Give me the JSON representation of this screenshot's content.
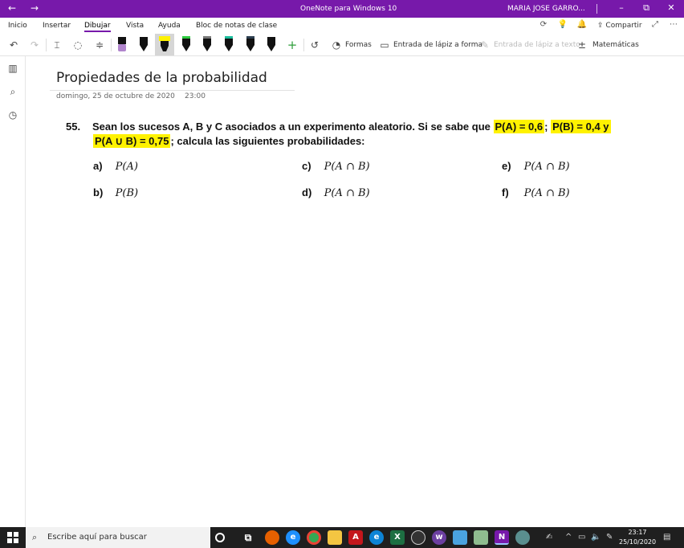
{
  "titlebar": {
    "back_icon": "arrow-left-icon",
    "forward_icon": "arrow-right-icon",
    "app_title": "OneNote para Windows 10",
    "user_name": "MARIA JOSE GARRO...",
    "color": "#7719aa"
  },
  "menu": {
    "tabs": [
      "Inicio",
      "Insertar",
      "Dibujar",
      "Vista",
      "Ayuda",
      "Bloc de notas de clase"
    ],
    "active_tab": "Dibujar",
    "share_label": "Compartir"
  },
  "toolbar": {
    "shapes_label": "Formas",
    "ink_to_shape_label": "Entrada de lápiz a forma",
    "ink_to_text_label": "Entrada de lápiz a texto",
    "math_label": "Matemáticas",
    "pens": [
      {
        "icon": "pen-icon",
        "color": "#9b59b6"
      },
      {
        "icon": "pen-icon",
        "color": "#000000"
      },
      {
        "icon": "highlighter-icon",
        "color": "#fff200"
      },
      {
        "icon": "pen-icon",
        "color": "#2ecc40"
      },
      {
        "icon": "pen-icon",
        "color": "#000000"
      },
      {
        "icon": "pen-icon",
        "color": "#1abc9c"
      },
      {
        "icon": "pen-icon",
        "color": "#2c3e50"
      },
      {
        "icon": "pen-icon",
        "color": "#000000"
      }
    ]
  },
  "page": {
    "title": "Propiedades de la probabilidad",
    "date": "domingo, 25 de octubre de 2020",
    "time": "23:00"
  },
  "problem": {
    "number": "55.",
    "line1_text": "Sean los sucesos A, B y C asociados a un experimento aleatorio. Si se sabe que",
    "pA": "P(A) = 0,6",
    "sep1": ";",
    "pB": "P(B) = 0,4 y",
    "pAuB": "P(A ∪ B) = 0,75",
    "line2_rest": "; calcula las siguientes probabilidades:",
    "highlight_color": "#fff200",
    "items": [
      {
        "label": "a)",
        "expr": "P(A)"
      },
      {
        "label": "c)",
        "expr": "P(A ∩ B)"
      },
      {
        "label": "e)",
        "expr": "P(A ∩ B)"
      },
      {
        "label": "b)",
        "expr": "P(B)"
      },
      {
        "label": "d)",
        "expr": "P(A ∩ B)"
      },
      {
        "label": "f)",
        "expr": "P(A ∩ B)"
      }
    ]
  },
  "taskbar": {
    "search_placeholder": "Escribe aquí para buscar",
    "time": "23:17",
    "date": "25/10/2020"
  }
}
